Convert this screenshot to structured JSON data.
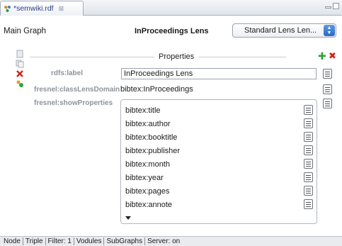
{
  "tab": {
    "label": "*semwiki.rdf",
    "close_glyph": "⊠"
  },
  "header": {
    "graph_label": "Main Graph",
    "lens_name": "InProceedings Lens",
    "lens_select": {
      "selected": "Standard Lens Len...",
      "arrow_up": "▲",
      "arrow_down": "▼"
    }
  },
  "left_toolbar": {
    "icons": [
      "document-icon",
      "copy-icon",
      "delete-icon",
      "add-node-icon"
    ]
  },
  "properties": {
    "title": "Properties",
    "add_glyph": "✚",
    "remove_glyph": "✖",
    "rows": [
      {
        "label": "rdfs:label",
        "value": "InProceedings Lens"
      },
      {
        "label": "fresnel:classLensDomain",
        "value": "bibtex:InProceedings"
      },
      {
        "label": "fresnel:showProperties"
      }
    ],
    "show_properties": [
      "bibtex:title",
      "bibtex:author",
      "bibtex:booktitle",
      "bibtex:publisher",
      "bibtex:month",
      "bibtex:year",
      "bibtex:pages",
      "bibtex:annote"
    ]
  },
  "statusbar": [
    "Node",
    "Triple",
    "Filter: 1",
    "Vodules",
    "SubGraphs",
    "Server: on"
  ],
  "colors": {
    "accent_blue": "#2a68c8",
    "add_green": "#2fa43a",
    "remove_red": "#d2251b"
  }
}
